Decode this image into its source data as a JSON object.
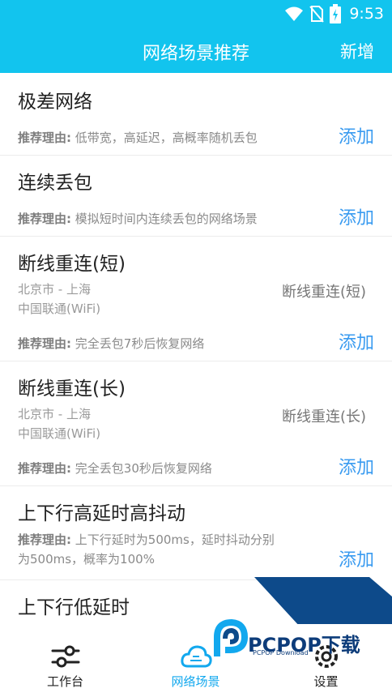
{
  "status": {
    "time": "9:53"
  },
  "header": {
    "title": "网络场景推荐",
    "add_label": "新增"
  },
  "reason_prefix": "推荐理由:",
  "add_label": "添加",
  "cards": [
    {
      "title": "极差网络",
      "reason": "低带宽，高延迟，高概率随机丢包"
    },
    {
      "title": "连续丢包",
      "reason": "模拟短时间内连续丢包的网络场景"
    },
    {
      "title": "断线重连(短)",
      "location": "北京市 - 上海",
      "network": "中国联通(WiFi)",
      "tag": "断线重连(短)",
      "reason": "完全丢包7秒后恢复网络"
    },
    {
      "title": "断线重连(长)",
      "location": "北京市 - 上海",
      "network": "中国联通(WiFi)",
      "tag": "断线重连(长)",
      "reason": "完全丢包30秒后恢复网络"
    },
    {
      "title": "上下行高延时高抖动",
      "reason": "上下行延时为500ms，延时抖动分别为500ms，概率为100%"
    },
    {
      "title": "上下行低延时"
    }
  ],
  "tabs": [
    {
      "label": "工作台",
      "icon": "sliders-icon"
    },
    {
      "label": "网络场景",
      "icon": "cloud-icon"
    },
    {
      "label": "设置",
      "icon": "gear-icon"
    }
  ],
  "watermark": {
    "text": "PCPOP下载",
    "sub": "PCPOP Download"
  },
  "colors": {
    "primary": "#12c4ee",
    "link": "#3a9bf0",
    "watermark": "#0d4a8a"
  }
}
